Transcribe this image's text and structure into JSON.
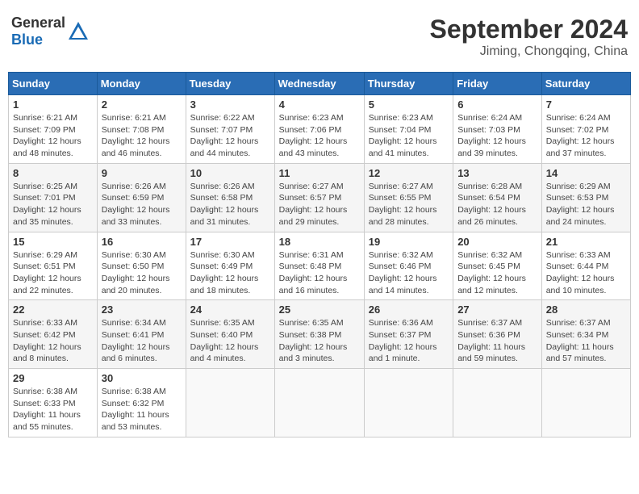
{
  "header": {
    "logo_general": "General",
    "logo_blue": "Blue",
    "month_title": "September 2024",
    "location": "Jiming, Chongqing, China"
  },
  "weekdays": [
    "Sunday",
    "Monday",
    "Tuesday",
    "Wednesday",
    "Thursday",
    "Friday",
    "Saturday"
  ],
  "weeks": [
    [
      {
        "day": "1",
        "sunrise": "6:21 AM",
        "sunset": "7:09 PM",
        "daylight": "12 hours and 48 minutes."
      },
      {
        "day": "2",
        "sunrise": "6:21 AM",
        "sunset": "7:08 PM",
        "daylight": "12 hours and 46 minutes."
      },
      {
        "day": "3",
        "sunrise": "6:22 AM",
        "sunset": "7:07 PM",
        "daylight": "12 hours and 44 minutes."
      },
      {
        "day": "4",
        "sunrise": "6:23 AM",
        "sunset": "7:06 PM",
        "daylight": "12 hours and 43 minutes."
      },
      {
        "day": "5",
        "sunrise": "6:23 AM",
        "sunset": "7:04 PM",
        "daylight": "12 hours and 41 minutes."
      },
      {
        "day": "6",
        "sunrise": "6:24 AM",
        "sunset": "7:03 PM",
        "daylight": "12 hours and 39 minutes."
      },
      {
        "day": "7",
        "sunrise": "6:24 AM",
        "sunset": "7:02 PM",
        "daylight": "12 hours and 37 minutes."
      }
    ],
    [
      {
        "day": "8",
        "sunrise": "6:25 AM",
        "sunset": "7:01 PM",
        "daylight": "12 hours and 35 minutes."
      },
      {
        "day": "9",
        "sunrise": "6:26 AM",
        "sunset": "6:59 PM",
        "daylight": "12 hours and 33 minutes."
      },
      {
        "day": "10",
        "sunrise": "6:26 AM",
        "sunset": "6:58 PM",
        "daylight": "12 hours and 31 minutes."
      },
      {
        "day": "11",
        "sunrise": "6:27 AM",
        "sunset": "6:57 PM",
        "daylight": "12 hours and 29 minutes."
      },
      {
        "day": "12",
        "sunrise": "6:27 AM",
        "sunset": "6:55 PM",
        "daylight": "12 hours and 28 minutes."
      },
      {
        "day": "13",
        "sunrise": "6:28 AM",
        "sunset": "6:54 PM",
        "daylight": "12 hours and 26 minutes."
      },
      {
        "day": "14",
        "sunrise": "6:29 AM",
        "sunset": "6:53 PM",
        "daylight": "12 hours and 24 minutes."
      }
    ],
    [
      {
        "day": "15",
        "sunrise": "6:29 AM",
        "sunset": "6:51 PM",
        "daylight": "12 hours and 22 minutes."
      },
      {
        "day": "16",
        "sunrise": "6:30 AM",
        "sunset": "6:50 PM",
        "daylight": "12 hours and 20 minutes."
      },
      {
        "day": "17",
        "sunrise": "6:30 AM",
        "sunset": "6:49 PM",
        "daylight": "12 hours and 18 minutes."
      },
      {
        "day": "18",
        "sunrise": "6:31 AM",
        "sunset": "6:48 PM",
        "daylight": "12 hours and 16 minutes."
      },
      {
        "day": "19",
        "sunrise": "6:32 AM",
        "sunset": "6:46 PM",
        "daylight": "12 hours and 14 minutes."
      },
      {
        "day": "20",
        "sunrise": "6:32 AM",
        "sunset": "6:45 PM",
        "daylight": "12 hours and 12 minutes."
      },
      {
        "day": "21",
        "sunrise": "6:33 AM",
        "sunset": "6:44 PM",
        "daylight": "12 hours and 10 minutes."
      }
    ],
    [
      {
        "day": "22",
        "sunrise": "6:33 AM",
        "sunset": "6:42 PM",
        "daylight": "12 hours and 8 minutes."
      },
      {
        "day": "23",
        "sunrise": "6:34 AM",
        "sunset": "6:41 PM",
        "daylight": "12 hours and 6 minutes."
      },
      {
        "day": "24",
        "sunrise": "6:35 AM",
        "sunset": "6:40 PM",
        "daylight": "12 hours and 4 minutes."
      },
      {
        "day": "25",
        "sunrise": "6:35 AM",
        "sunset": "6:38 PM",
        "daylight": "12 hours and 3 minutes."
      },
      {
        "day": "26",
        "sunrise": "6:36 AM",
        "sunset": "6:37 PM",
        "daylight": "12 hours and 1 minute."
      },
      {
        "day": "27",
        "sunrise": "6:37 AM",
        "sunset": "6:36 PM",
        "daylight": "11 hours and 59 minutes."
      },
      {
        "day": "28",
        "sunrise": "6:37 AM",
        "sunset": "6:34 PM",
        "daylight": "11 hours and 57 minutes."
      }
    ],
    [
      {
        "day": "29",
        "sunrise": "6:38 AM",
        "sunset": "6:33 PM",
        "daylight": "11 hours and 55 minutes."
      },
      {
        "day": "30",
        "sunrise": "6:38 AM",
        "sunset": "6:32 PM",
        "daylight": "11 hours and 53 minutes."
      },
      null,
      null,
      null,
      null,
      null
    ]
  ]
}
